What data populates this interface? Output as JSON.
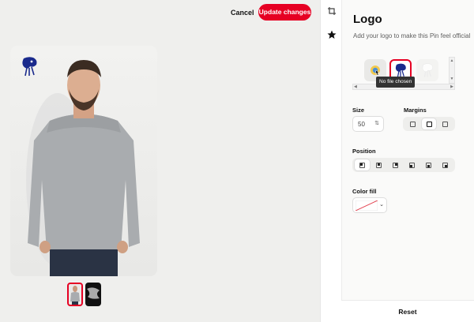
{
  "header": {
    "cancel_label": "Cancel",
    "update_label": "Update changes"
  },
  "panel": {
    "title": "Logo",
    "subtitle": "Add your logo to make this Pin feel official",
    "tooltip": "No file chosen",
    "size": {
      "label": "Size",
      "value": "50"
    },
    "margins": {
      "label": "Margins",
      "options": [
        "none",
        "medium",
        "large"
      ],
      "selected": "medium"
    },
    "position": {
      "label": "Position",
      "options": [
        "top-left",
        "top-center",
        "top-right",
        "bottom-left",
        "bottom-center",
        "bottom-right"
      ],
      "selected": "top-left"
    },
    "color_fill": {
      "label": "Color fill",
      "value": "none"
    },
    "reset_label": "Reset"
  },
  "colors": {
    "accent": "#e60023",
    "logo_blue": "#1a2a8c"
  },
  "icons": {
    "tool_1": "crop-icon",
    "tool_2": "star-icon"
  }
}
